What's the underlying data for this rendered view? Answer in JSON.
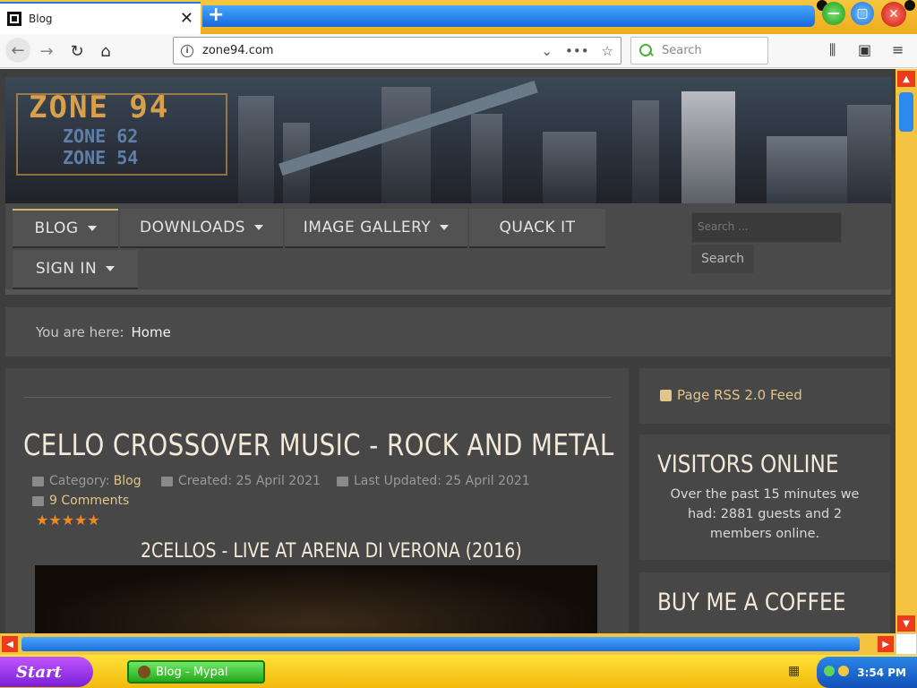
{
  "browser": {
    "tab_title": "Blog",
    "tab_close": "✕",
    "new_tab": "+",
    "url": "zone94.com",
    "search_placeholder": "Search",
    "icons": [
      "back-arrow-icon",
      "forward-arrow-icon",
      "reload-icon",
      "home-icon",
      "info-icon",
      "chevron-down-icon",
      "more-icon",
      "bookmark-star-icon",
      "library-icon",
      "sidebar-icon",
      "menu-icon"
    ]
  },
  "banner": {
    "logo": "ZONE 94",
    "sub1": "ZONE 62",
    "sub2": "ZONE 54"
  },
  "menu": {
    "items": [
      {
        "label": "BLOG",
        "has_caret": true
      },
      {
        "label": "DOWNLOADS",
        "has_caret": true
      },
      {
        "label": "IMAGE GALLERY",
        "has_caret": true
      },
      {
        "label": "QUACK IT",
        "has_caret": false
      },
      {
        "label": "SIGN IN",
        "has_caret": true
      }
    ],
    "search_placeholder": "Search ...",
    "search_button": "Search"
  },
  "breadcrumb": {
    "label": "You are here:",
    "home": "Home"
  },
  "article": {
    "title": "CELLO CROSSOVER MUSIC - ROCK AND METAL",
    "category_label": "Category:",
    "category": "Blog",
    "created": "Created: 25 April 2021",
    "updated": "Last Updated: 25 April 2021",
    "comments": "9 Comments",
    "stars": "★★★★★",
    "rating": 5,
    "section_heading": "2CELLOS - LIVE AT ARENA DI VERONA (2016)"
  },
  "sidebar": {
    "rss": "Page RSS 2.0 Feed",
    "visitors_title": "VISITORS ONLINE",
    "visitors_text": "Over the past 15 minutes we had: 2881 guests and 2 members online.",
    "coffee_title": "BUY ME A COFFEE"
  },
  "taskbar": {
    "start": "Start",
    "task": "Blog - Mypal",
    "time": "3:54 PM"
  }
}
